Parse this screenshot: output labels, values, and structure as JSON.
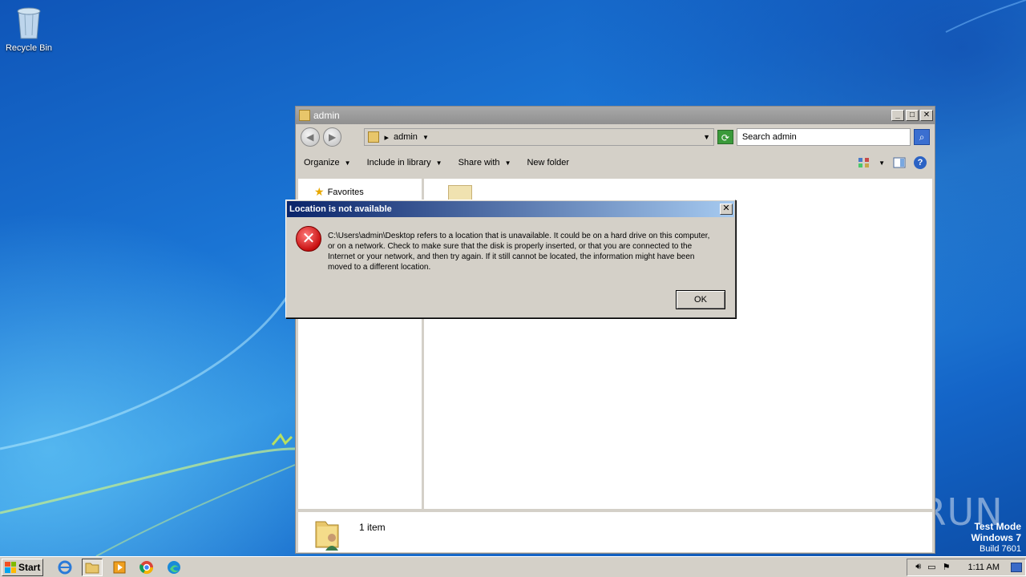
{
  "desktop": {
    "recycle_bin_label": "Recycle Bin",
    "watermark": {
      "line1": "Test Mode",
      "line2": "Windows 7",
      "line3": "Build 7601"
    },
    "anyrun_logo": "ANY RUN"
  },
  "explorer": {
    "title": "admin",
    "address": {
      "breadcrumb_sep": "▸",
      "location": "admin"
    },
    "search_placeholder": "Search admin",
    "commands": {
      "organize": "Organize",
      "include_in_library": "Include in library",
      "share_with": "Share with",
      "new_folder": "New folder"
    },
    "nav": {
      "favorites": "Favorites"
    },
    "details": {
      "item_count": "1 item"
    }
  },
  "dialog": {
    "title": "Location is not available",
    "message": "C:\\Users\\admin\\Desktop refers to a location that is unavailable. It could be on a hard drive on this computer, or on a network. Check to make sure that the disk is properly inserted, or that you are connected to the Internet or your network, and then try again. If it still cannot be located, the information might have been moved to a different location.",
    "ok_label": "OK",
    "close_glyph": "✕"
  },
  "taskbar": {
    "start_label": "Start",
    "apps": [
      "internet-explorer",
      "windows-explorer",
      "media-player",
      "chrome",
      "edge"
    ],
    "clock": "1:11 AM"
  }
}
